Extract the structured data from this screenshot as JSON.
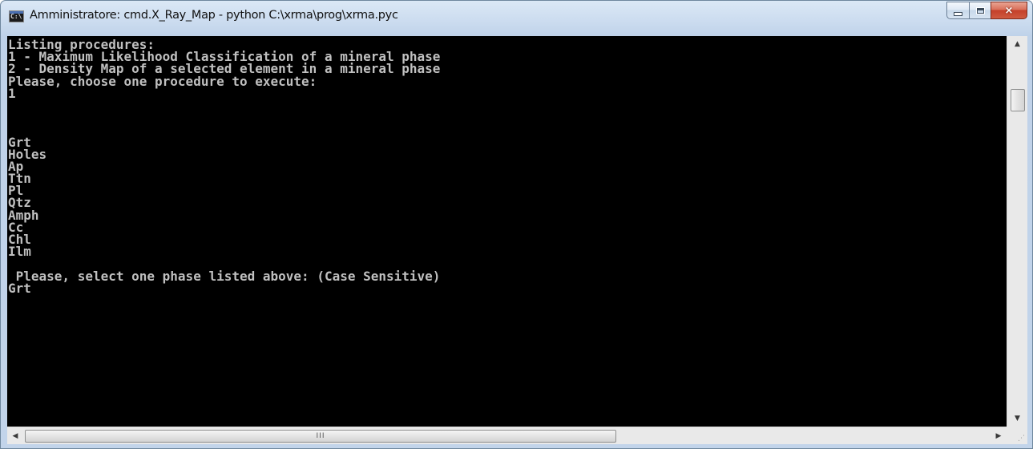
{
  "window": {
    "title": "Amministratore: cmd.X_Ray_Map - python  C:\\xrma\\prog\\xrma.pyc",
    "icon": "cmd-icon",
    "icon_text": "C:\\",
    "buttons": {
      "minimize": "minimize-icon",
      "maximize": "maximize-icon",
      "close": "×"
    }
  },
  "console": {
    "background": "#000000",
    "foreground": "#c0c0c0",
    "lines": [
      "Listing procedures:",
      "1 - Maximum Likelihood Classification of a mineral phase",
      "2 - Density Map of a selected element in a mineral phase",
      "Please, choose one procedure to execute:",
      "1",
      "",
      "",
      "",
      "Grt",
      "Holes",
      "Ap",
      "Ttn",
      "Pl",
      "Qtz",
      "Amph",
      "Cc",
      "Chl",
      "Ilm",
      "",
      " Please, select one phase listed above: (Case Sensitive)",
      "Grt"
    ]
  },
  "scrollbars": {
    "up_arrow": "▲",
    "down_arrow": "▼",
    "left_arrow": "◀",
    "right_arrow": "▶",
    "thumb_grip": "III",
    "size_grip": "⋰"
  }
}
